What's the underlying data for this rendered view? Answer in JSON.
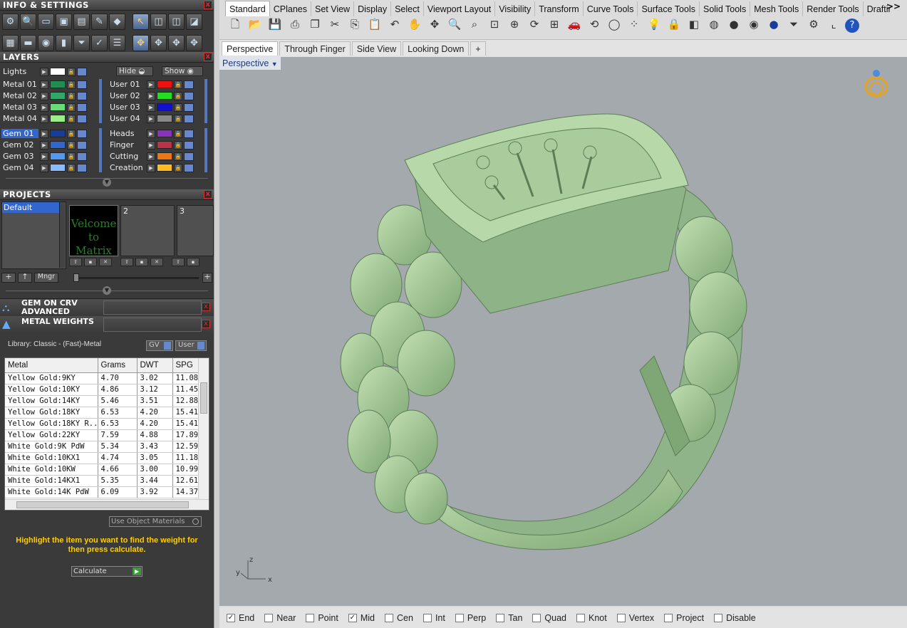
{
  "panels": {
    "info": "INFO & SETTINGS",
    "layers": "LAYERS",
    "projects": "PROJECTS",
    "gem_on_crv": "GEM ON CRV",
    "advanced": "ADVANCED",
    "metal_weights": "METAL WEIGHTS",
    "close": "x"
  },
  "layers": {
    "lights": "Lights",
    "hide": "Hide",
    "show": "Show",
    "left": [
      {
        "name": "Metal 01",
        "color": "#1f8f4f"
      },
      {
        "name": "Metal 02",
        "color": "#2fa86a"
      },
      {
        "name": "Metal 03",
        "color": "#66dd77"
      },
      {
        "name": "Metal 04",
        "color": "#99ee88"
      },
      {
        "name": "Gem 01",
        "color": "#1a3c99",
        "selected": true
      },
      {
        "name": "Gem 02",
        "color": "#3366cc"
      },
      {
        "name": "Gem 03",
        "color": "#5599ee"
      },
      {
        "name": "Gem 04",
        "color": "#88bbff"
      }
    ],
    "right": [
      {
        "name": "User 01",
        "color": "#ee1111"
      },
      {
        "name": "User 02",
        "color": "#22dd22"
      },
      {
        "name": "User 03",
        "color": "#1111cc"
      },
      {
        "name": "User 04",
        "color": "#888888"
      },
      {
        "name": "Heads",
        "color": "#8833bb"
      },
      {
        "name": "Finger",
        "color": "#bb3344"
      },
      {
        "name": "Cutting",
        "color": "#ee7711"
      },
      {
        "name": "Creation",
        "color": "#ffbb22"
      }
    ]
  },
  "projects": {
    "default": "Default",
    "slot1_text": "Velcome to Matrix",
    "slot2": "2",
    "slot3": "3",
    "mngr": "Mngr",
    "plus": "+",
    "up": "↑"
  },
  "metal_weights": {
    "library": "Library: Classic - (Fast)-Metal",
    "gv": "GV",
    "user": "User",
    "headers": [
      "Metal",
      "Grams",
      "DWT",
      "SPG"
    ],
    "rows": [
      [
        "Yellow Gold:9KY",
        "4.70",
        "3.02",
        "11.08"
      ],
      [
        "Yellow Gold:10KY",
        "4.86",
        "3.12",
        "11.45"
      ],
      [
        "Yellow Gold:14KY",
        "5.46",
        "3.51",
        "12.88"
      ],
      [
        "Yellow Gold:18KY",
        "6.53",
        "4.20",
        "15.41"
      ],
      [
        "Yellow Gold:18KY R...",
        "6.53",
        "4.20",
        "15.41"
      ],
      [
        "Yellow Gold:22KY",
        "7.59",
        "4.88",
        "17.89"
      ],
      [
        "White Gold:9K PdW",
        "5.34",
        "3.43",
        "12.59"
      ],
      [
        "White Gold:10KX1",
        "4.74",
        "3.05",
        "11.18"
      ],
      [
        "White Gold:10KW",
        "4.66",
        "3.00",
        "10.99"
      ],
      [
        "White Gold:14KX1",
        "5.35",
        "3.44",
        "12.61"
      ],
      [
        "White Gold:14K PdW",
        "6.09",
        "3.92",
        "14.37"
      ]
    ],
    "use_obj": "Use Object Materials",
    "hint": "Highlight the item you want to find the weight for then press calculate.",
    "calculate": "Calculate"
  },
  "menu_tabs": [
    "Standard",
    "CPlanes",
    "Set View",
    "Display",
    "Select",
    "Viewport Layout",
    "Visibility",
    "Transform",
    "Curve Tools",
    "Surface Tools",
    "Solid Tools",
    "Mesh Tools",
    "Render Tools",
    "Draftir"
  ],
  "menu_more": ">>",
  "view_tabs": [
    "Perspective",
    "Through Finger",
    "Side View",
    "Looking Down"
  ],
  "view_add": "+",
  "viewport_label": "Perspective",
  "axes": {
    "x": "x",
    "y": "y",
    "z": "z"
  },
  "snaps": [
    {
      "label": "End",
      "checked": true
    },
    {
      "label": "Near",
      "checked": false
    },
    {
      "label": "Point",
      "checked": false
    },
    {
      "label": "Mid",
      "checked": true
    },
    {
      "label": "Cen",
      "checked": false
    },
    {
      "label": "Int",
      "checked": false
    },
    {
      "label": "Perp",
      "checked": false
    },
    {
      "label": "Tan",
      "checked": false
    },
    {
      "label": "Quad",
      "checked": false
    },
    {
      "label": "Knot",
      "checked": false
    },
    {
      "label": "Vertex",
      "checked": false
    },
    {
      "label": "Project",
      "checked": false
    },
    {
      "label": "Disable",
      "checked": false
    }
  ]
}
